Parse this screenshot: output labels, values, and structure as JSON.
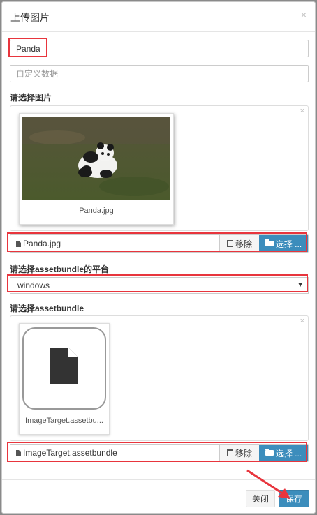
{
  "dialog": {
    "title": "上传图片",
    "close_glyph": "×"
  },
  "form": {
    "name_value": "Panda",
    "custom_data_placeholder": "自定义数据",
    "image_label": "请选择图片",
    "platform_label": "请选择assetbundle的平台",
    "platform_value": "windows",
    "bundle_label": "请选择assetbundle"
  },
  "image_upload": {
    "preview_caption": "Panda.jpg",
    "file_name": "Panda.jpg",
    "remove_label": "移除",
    "select_label": "选择 ..."
  },
  "bundle_upload": {
    "preview_caption": "ImageTarget.assetbu...",
    "file_name": "ImageTarget.assetbundle",
    "remove_label": "移除",
    "select_label": "选择 ..."
  },
  "footer": {
    "close_label": "关闭",
    "save_label": "保存"
  },
  "colors": {
    "primary": "#3c8dbc",
    "highlight": "#e8353d"
  },
  "icons": [
    "close-icon",
    "file-icon",
    "trash-icon",
    "folder-open-icon",
    "caret-down-icon",
    "document-icon"
  ]
}
